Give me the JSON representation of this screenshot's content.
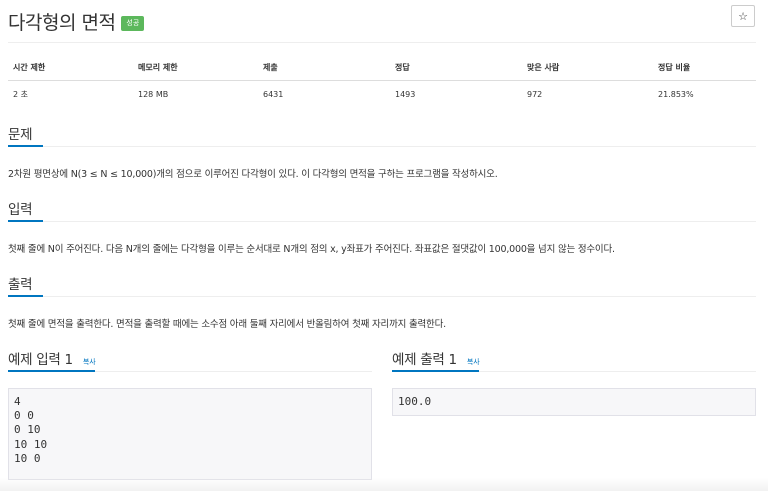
{
  "problem": {
    "title": "다각형의 면적",
    "status_badge": "성공",
    "star_icon": "☆"
  },
  "info_table": {
    "headers": [
      "시간 제한",
      "메모리 제한",
      "제출",
      "정답",
      "맞은 사람",
      "정답 비율"
    ],
    "values": [
      "2 초",
      "128 MB",
      "6431",
      "1493",
      "972",
      "21.853%"
    ]
  },
  "sections": {
    "problem": {
      "heading": "문제",
      "text": "2차원 평면상에 N(3 ≤ N ≤ 10,000)개의 점으로 이루어진 다각형이 있다. 이 다각형의 면적을 구하는 프로그램을 작성하시오."
    },
    "input": {
      "heading": "입력",
      "text": "첫째 줄에 N이 주어진다. 다음 N개의 줄에는 다각형을 이루는 순서대로 N개의 점의 x, y좌표가 주어진다. 좌표값은 절댓값이 100,000을 넘지 않는 정수이다."
    },
    "output": {
      "heading": "출력",
      "text": "첫째 줄에 면적을 출력한다. 면적을 출력할 때에는 소수점 아래 둘째 자리에서 반올림하여 첫째 자리까지 출력한다."
    }
  },
  "samples": {
    "input": {
      "heading": "예제 입력 1",
      "copy_label": "복사",
      "content": "4\n0 0\n0 10\n10 10\n10 0"
    },
    "output": {
      "heading": "예제 출력 1",
      "copy_label": "복사",
      "content": "100.0"
    }
  },
  "colors": {
    "accent": "#0076c0",
    "success": "#5cb85c"
  }
}
